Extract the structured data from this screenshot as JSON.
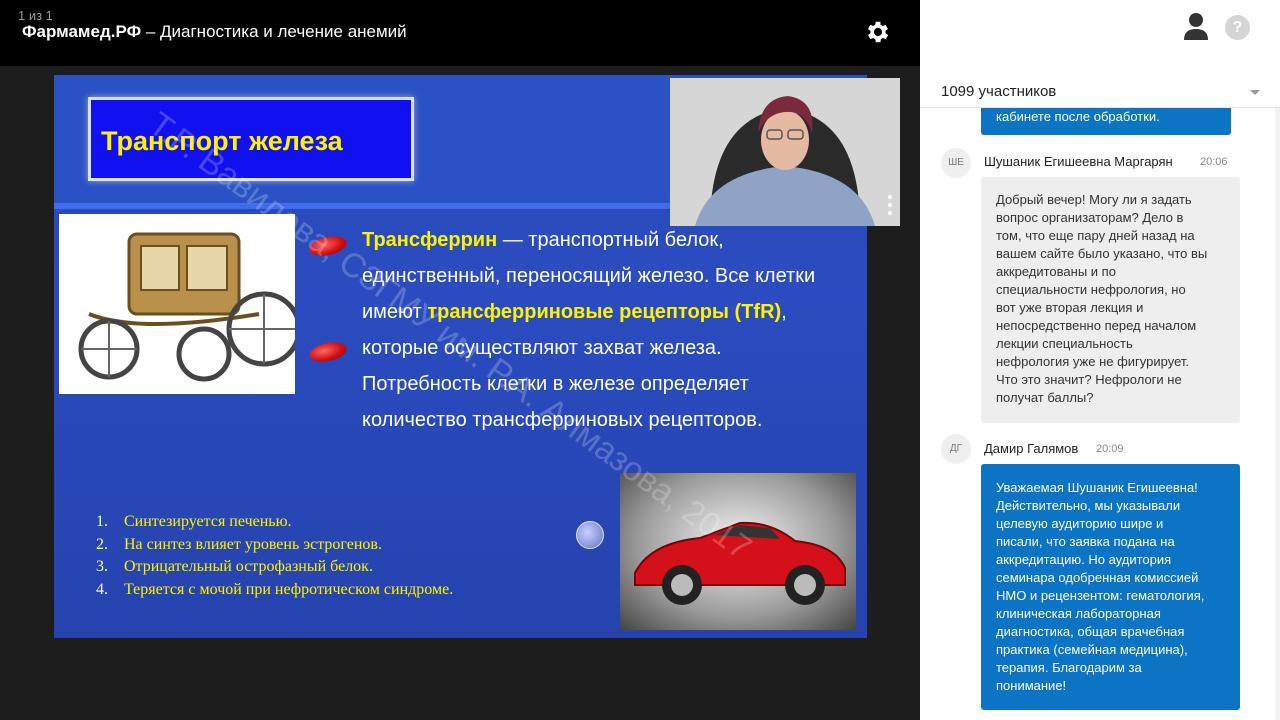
{
  "stage": {
    "page_counter": "1 из 1",
    "title_brand": "Фармамед.РФ",
    "title_rest": " – Диагностика и лечение анемий"
  },
  "slide": {
    "title": "Транспорт железа",
    "p1_highlight": "Трансферрин",
    "p1_rest": " — транспортный белок, единственный, переносящий железо. Все клетки имеют ",
    "p1_highlight2": "трансферриновые рецепторы (TfR)",
    "p1_rest2": ", которые осуществляют захват железа. Потребность клетки в железе определяет количество трансферриновых рецепторов.",
    "list": [
      {
        "num": "1.",
        "text": "Синтезируется печенью."
      },
      {
        "num": "2.",
        "text": "На синтез влияет уровень эстрогенов."
      },
      {
        "num": "3.",
        "text": "Отрицательный острофазный белок."
      },
      {
        "num": "4.",
        "text": "Теряется с мочой при нефротическом синдроме."
      }
    ],
    "watermark": "Т.Р. Вавилова, СЗГМУ им. Р.А. Алмазова, 2017"
  },
  "panel": {
    "help_label": "?",
    "participants": "1099 участников"
  },
  "chat": {
    "prev_tail": "кабинете после обработки.",
    "msg1": {
      "initials": "ШЕ",
      "author": "Шушаник Егишеевна Маргарян",
      "time": "20:06",
      "lines": [
        "Добрый вечер! Могу ли я задать",
        "вопрос организаторам? Дело в",
        "том, что еще пару дней назад на",
        "вашем сайте было указано, что вы",
        "аккредитованы и по",
        "специальности нефрология, но",
        "вот уже вторая лекция и",
        "непосредственно перед началом",
        "лекции специальность",
        "нефрология уже не фигурирует.",
        "Что это значит? Нефрологи не",
        "получат баллы?"
      ]
    },
    "msg2": {
      "initials": "ДГ",
      "author": "Дамир Галямов",
      "time": "20:09",
      "lines": [
        "Уважаемая Шушаник Егишеевна!",
        "Действительно,  мы указывали",
        "целевую аудиторию шире и",
        "писали,  что заявка подана на",
        "аккредитацию. Но аудитория",
        "семинара одобренная комиссией",
        "НМО и рецензентом: гематология,",
        "клиническая лабораторная",
        "диагностика, общая врачебная",
        "практика (семейная медицина),",
        "терапия. Благодарим за",
        "понимание!"
      ]
    }
  }
}
